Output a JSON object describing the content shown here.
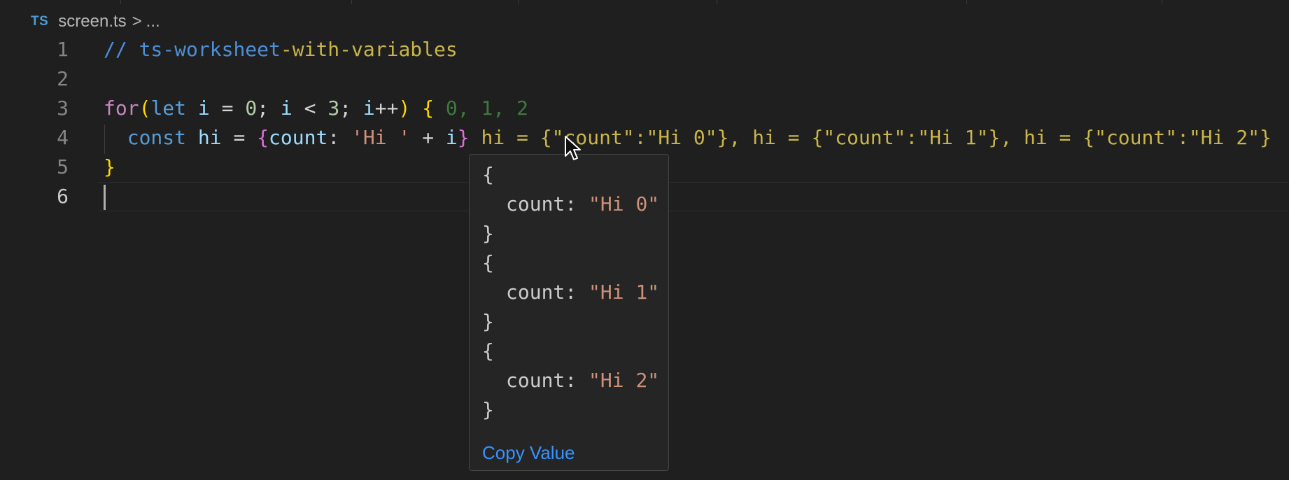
{
  "breadcrumb": {
    "language_badge": "TS",
    "file_name": "screen.ts",
    "separator": ">",
    "ellipsis": "..."
  },
  "editor": {
    "line_numbers": [
      "1",
      "2",
      "3",
      "4",
      "5",
      "6"
    ],
    "active_line": "6",
    "line1": {
      "comment_prefix": "// ",
      "highlight": "ts-worksheet",
      "rest": "-with-variables"
    },
    "line3": {
      "kw_for": "for",
      "paren_open": "(",
      "kw_let": "let",
      "var_i": "i",
      "assign": " = ",
      "zero": "0",
      "semi1": "; ",
      "var_i2": "i",
      "lt": " < ",
      "three": "3",
      "semi2": "; ",
      "var_i3": "i",
      "incr": "++",
      "paren_close": ")",
      "brace_open": "{",
      "inlay": "0, 1, 2"
    },
    "line4": {
      "kw_const": "const",
      "var_hi": "hi",
      "assign": " = ",
      "brace_open": "{",
      "prop": "count",
      "colon": ": ",
      "str": "'Hi '",
      "plus": " + ",
      "var_i": "i",
      "brace_close": "}",
      "inlay": "hi = {\"count\":\"Hi 0\"}, hi = {\"count\":\"Hi 1\"}, hi = {\"count\":\"Hi 2\"}"
    },
    "line5": {
      "brace_close": "}"
    }
  },
  "hover": {
    "lines": [
      "{",
      "count: ",
      "\"Hi 0\"",
      "}",
      "{",
      "count: ",
      "\"Hi 1\"",
      "}",
      "{",
      "count: ",
      "\"Hi 2\"",
      "}"
    ],
    "copy_label": "Copy Value"
  }
}
